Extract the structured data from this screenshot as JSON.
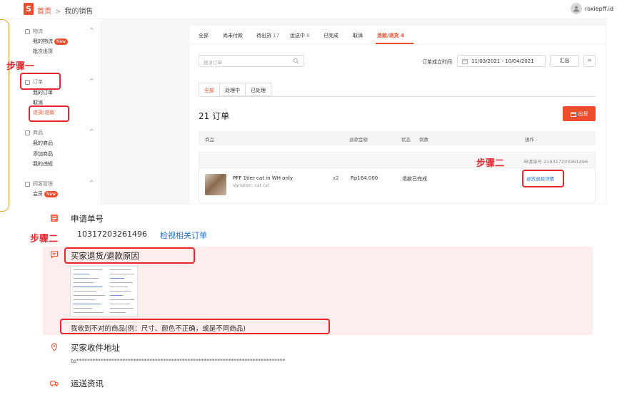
{
  "topbar": {
    "logo": "S",
    "home": "首页",
    "separator": ">",
    "current": "我的销售",
    "username": "roxiepff.id"
  },
  "sidebar": {
    "groups": [
      {
        "label": "物流",
        "items": [
          {
            "label": "我的物流",
            "badge": "New"
          },
          {
            "label": "批次出货"
          }
        ]
      },
      {
        "label": "订单",
        "items": [
          {
            "label": "我的订单"
          },
          {
            "label": "取消"
          },
          {
            "label": "退货/退款"
          }
        ]
      },
      {
        "label": "商品",
        "items": [
          {
            "label": "我的商品"
          },
          {
            "label": "添加商品"
          },
          {
            "label": "我的违规"
          }
        ]
      },
      {
        "label": "顾客管理",
        "items": [
          {
            "label": "会员",
            "badge": "New"
          }
        ]
      }
    ],
    "chevron": "^"
  },
  "tabs": [
    {
      "label": "全部",
      "count": ""
    },
    {
      "label": "尚未付款",
      "count": ""
    },
    {
      "label": "待出货",
      "count": "17"
    },
    {
      "label": "运送中",
      "count": "6"
    },
    {
      "label": "已完成",
      "count": ""
    },
    {
      "label": "取消",
      "count": ""
    },
    {
      "label": "退款/退货",
      "count": "4"
    }
  ],
  "toolbar": {
    "search_placeholder": "搜寻订单",
    "date_label": "订单成立时间",
    "date_range": "11/03/2021 - 10/04/2021",
    "export_label": "汇出",
    "menu_glyph": "≡"
  },
  "subtabs": [
    "全部",
    "处理中",
    "已处理"
  ],
  "orders_title": "21 订单",
  "ship_button": "出货",
  "table": {
    "headers": [
      "商品",
      "退款金额",
      "状态",
      "倒数",
      "操作"
    ]
  },
  "order": {
    "request_id": "申请单号 210317203261496",
    "product_name": "PFF 1tier cat in WH only",
    "variation": "Variation: cat cat",
    "quantity": "x2",
    "price": "Rp164.000",
    "status": "退款已完成",
    "action": "退货退款详情"
  },
  "annotations": {
    "step1": "步骤一",
    "step2a": "步骤二",
    "step2b": "步骤二"
  },
  "detail": {
    "request_title": "申请单号",
    "request_number": "10317203261496",
    "request_link": "检视相关订单",
    "reason_title": "买家退货/退款原因",
    "reason_text": "我收到不对的商品(例：尺寸、颜色不正确，或是不同商品)",
    "address_title": "买家收件地址",
    "address_value": "te*****************************************************************************",
    "shipping_title": "运送资讯"
  },
  "colors": {
    "brand": "#ee4d2d",
    "annotation": "#e8262d",
    "link": "#2673dd"
  }
}
